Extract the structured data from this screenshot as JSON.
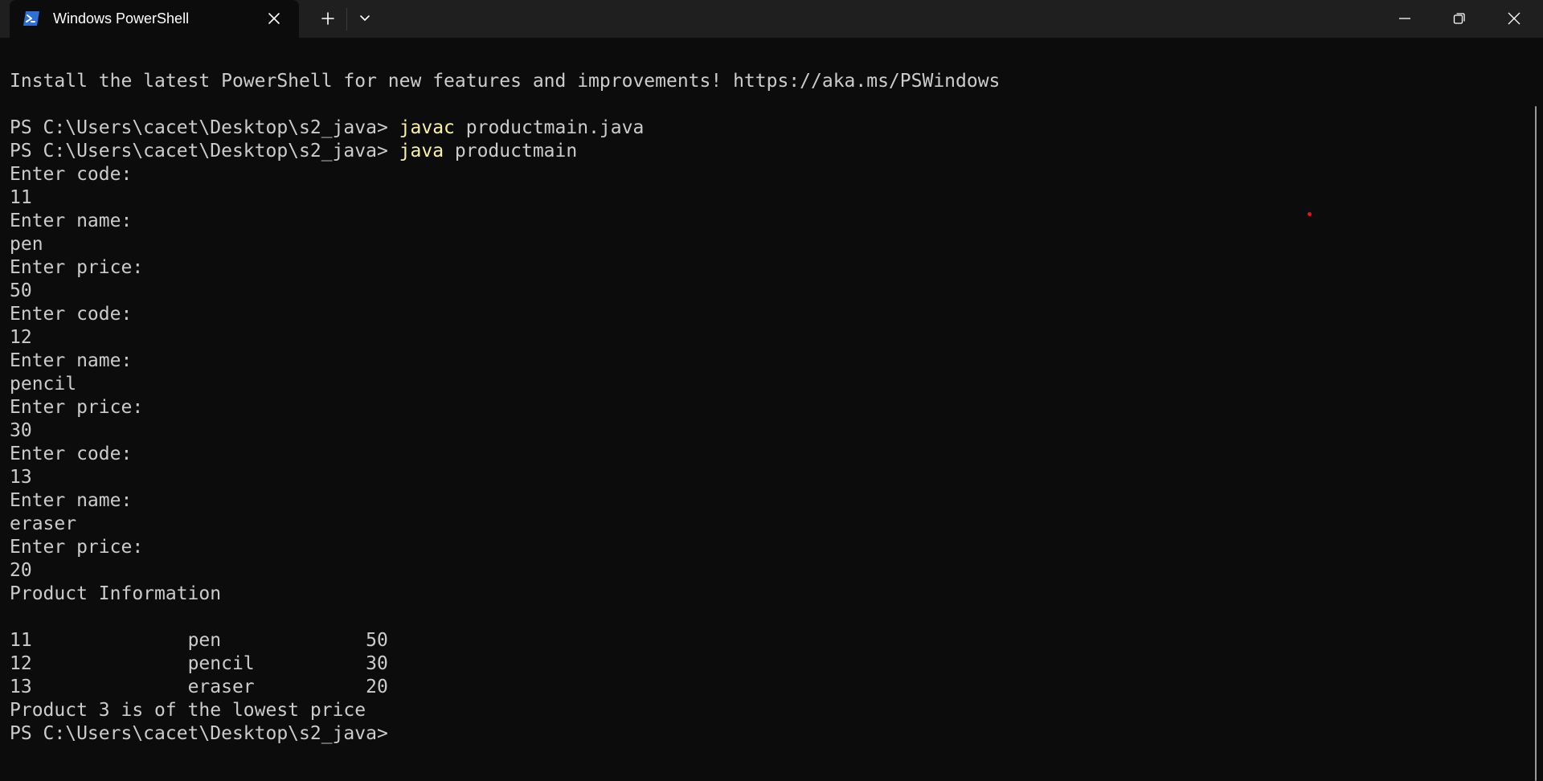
{
  "window": {
    "tab_title": "Windows PowerShell",
    "tab_icon": "powershell-icon",
    "buttons": {
      "close_tab": "close-icon",
      "new_tab": "plus-icon",
      "dropdown": "chevron-down-icon",
      "minimize": "minimize-icon",
      "maximize": "restore-icon",
      "close_window": "close-icon"
    }
  },
  "colors": {
    "terminal_bg": "#0c0c0c",
    "titlebar_bg": "#1f1f1f",
    "text": "#cccccc",
    "command": "#f9f1a5"
  },
  "terminal": {
    "banner": "Install the latest PowerShell for new features and improvements! https://aka.ms/PSWindows",
    "prompt": "PS C:\\Users\\cacet\\Desktop\\s2_java> ",
    "commands": [
      {
        "cmd": "javac",
        "args": " productmain.java"
      },
      {
        "cmd": "java",
        "args": " productmain"
      }
    ],
    "output": [
      "Enter code:",
      "11",
      "Enter name:",
      "pen",
      "Enter price:",
      "50",
      "Enter code:",
      "12",
      "Enter name:",
      "pencil",
      "Enter price:",
      "30",
      "Enter code:",
      "13",
      "Enter name:",
      "eraser",
      "Enter price:",
      "20",
      "Product Information",
      "",
      "11\t\tpen\t\t50",
      "12\t\tpencil\t\t30",
      "13\t\teraser\t\t20",
      "Product 3 is of the lowest price"
    ],
    "final_prompt": "PS C:\\Users\\cacet\\Desktop\\s2_java>"
  }
}
